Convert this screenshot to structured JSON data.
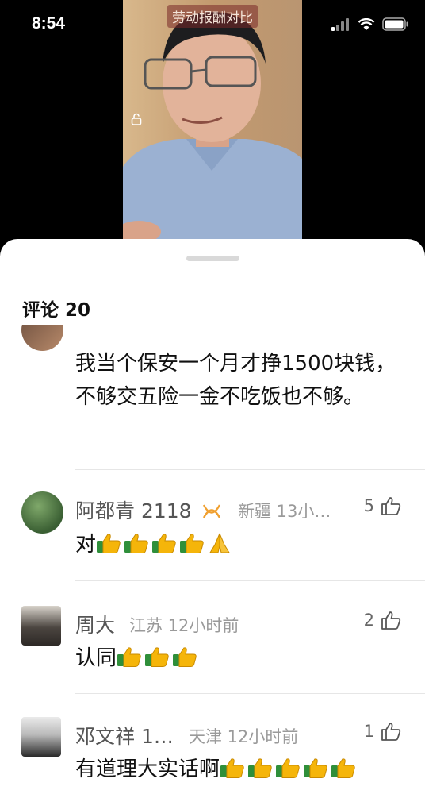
{
  "status": {
    "time": "8:54"
  },
  "video": {
    "title": "劳动报酬对比"
  },
  "sheet": {
    "title": "评论 20"
  },
  "comments": [
    {
      "text": "我当个保安一个月才挣1500块钱，不够交五险一金不吃饭也不够。"
    },
    {
      "name": "阿都青 2118",
      "location_time": "新疆 13小…",
      "likes": "5",
      "emoji_count": 5
    },
    {
      "name": "周大",
      "location_time": "江苏 12小时前",
      "likes": "2",
      "text": "认同"
    },
    {
      "name": "邓文祥 1…",
      "location_time": "天津 12小时前",
      "likes": "1",
      "text": "有道理大实话啊"
    }
  ],
  "comment2_text": "对",
  "icons": [
    "signal-icon",
    "wifi-icon",
    "battery-icon",
    "lock-icon",
    "thumbs-up-icon",
    "badge-icon"
  ],
  "colors": {
    "accent_emoji": "#f5b50a",
    "cuff": "#2f8f3a",
    "badge": "#f0a030"
  }
}
